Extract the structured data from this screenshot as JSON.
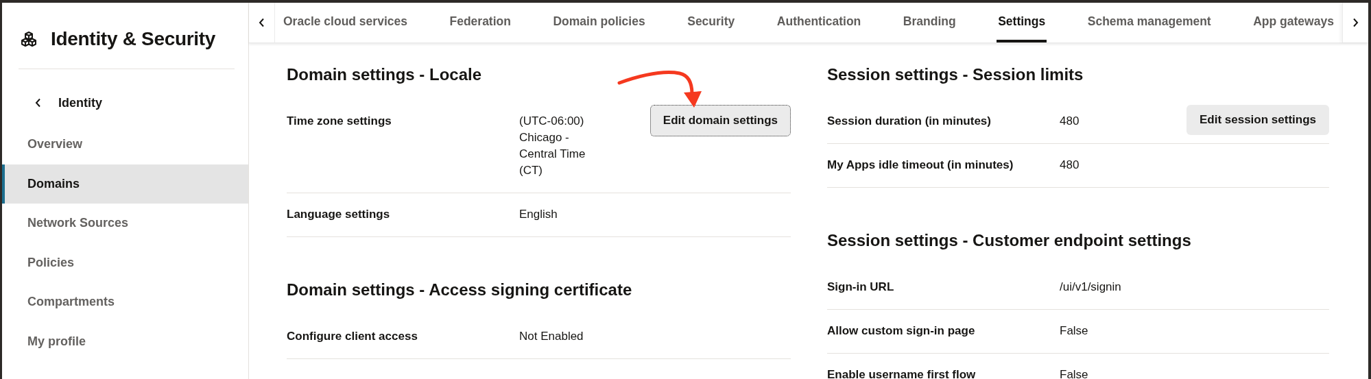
{
  "sidebar": {
    "title": "Identity & Security",
    "back_label": "Identity",
    "items": [
      {
        "label": "Overview",
        "selected": false
      },
      {
        "label": "Domains",
        "selected": true
      },
      {
        "label": "Network Sources",
        "selected": false
      },
      {
        "label": "Policies",
        "selected": false
      },
      {
        "label": "Compartments",
        "selected": false
      },
      {
        "label": "My profile",
        "selected": false
      }
    ]
  },
  "tabs": [
    {
      "label": "Oracle cloud services",
      "selected": false
    },
    {
      "label": "Federation",
      "selected": false
    },
    {
      "label": "Domain policies",
      "selected": false
    },
    {
      "label": "Security",
      "selected": false
    },
    {
      "label": "Authentication",
      "selected": false
    },
    {
      "label": "Branding",
      "selected": false
    },
    {
      "label": "Settings",
      "selected": true
    },
    {
      "label": "Schema management",
      "selected": false
    },
    {
      "label": "App gateways",
      "selected": false
    }
  ],
  "columns": [
    {
      "sections": [
        {
          "title": "Domain settings - Locale",
          "button": {
            "label": "Edit domain settings",
            "focused": true
          },
          "rows": [
            {
              "label": "Time zone settings",
              "value": "(UTC-06:00) Chicago - Central Time (CT)"
            },
            {
              "label": "Language settings",
              "value": "English"
            }
          ]
        },
        {
          "title": "Domain settings - Access signing certificate",
          "rows": [
            {
              "label": "Configure client access",
              "value": "Not Enabled"
            }
          ]
        }
      ]
    },
    {
      "sections": [
        {
          "title": "Session settings - Session limits",
          "button": {
            "label": "Edit session settings",
            "focused": false
          },
          "rows": [
            {
              "label": "Session duration (in minutes)",
              "value": "480"
            },
            {
              "label": "My Apps idle timeout (in minutes)",
              "value": "480"
            }
          ]
        },
        {
          "title": "Session settings - Customer endpoint settings",
          "rows": [
            {
              "label": "Sign-in URL",
              "value": "/ui/v1/signin"
            },
            {
              "label": "Allow custom sign-in page",
              "value": "False"
            },
            {
              "label": "Enable username first flow",
              "value": "False"
            }
          ]
        }
      ]
    }
  ]
}
